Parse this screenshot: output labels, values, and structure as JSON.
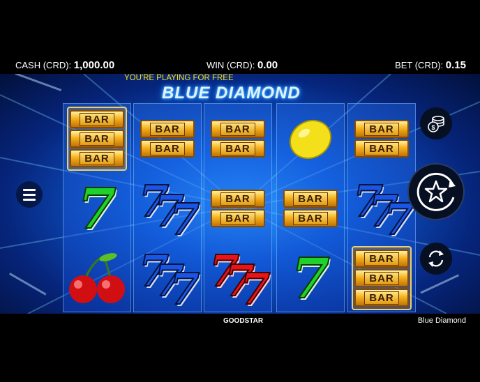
{
  "topbar": {
    "cash_label": "CASH (CRD):",
    "cash_value": "1,000.00",
    "win_label": "WIN (CRD):",
    "win_value": "0.00",
    "bet_label": "BET (CRD):",
    "bet_value": "0.15"
  },
  "banner": "YOU'RE PLAYING FOR FREE",
  "game_title": "BLUE DIAMOND",
  "reels": [
    [
      "triple-bar-highlighted",
      "green-seven",
      "cherries"
    ],
    [
      "double-bar",
      "blue-triple-seven",
      "blue-triple-seven"
    ],
    [
      "double-bar",
      "double-bar",
      "red-triple-seven"
    ],
    [
      "lemon",
      "double-bar",
      "green-seven"
    ],
    [
      "double-bar",
      "blue-triple-seven",
      "triple-bar-highlighted"
    ]
  ],
  "symbols": {
    "bar_text": "BAR",
    "seven_text": "7"
  },
  "buttons": {
    "menu": "menu-icon",
    "coins": "coins-icon",
    "spin": "star-spin-icon",
    "autoplay": "refresh-icon"
  },
  "footer": {
    "provider": "GOODSTAR",
    "title": "Blue Diamond"
  }
}
